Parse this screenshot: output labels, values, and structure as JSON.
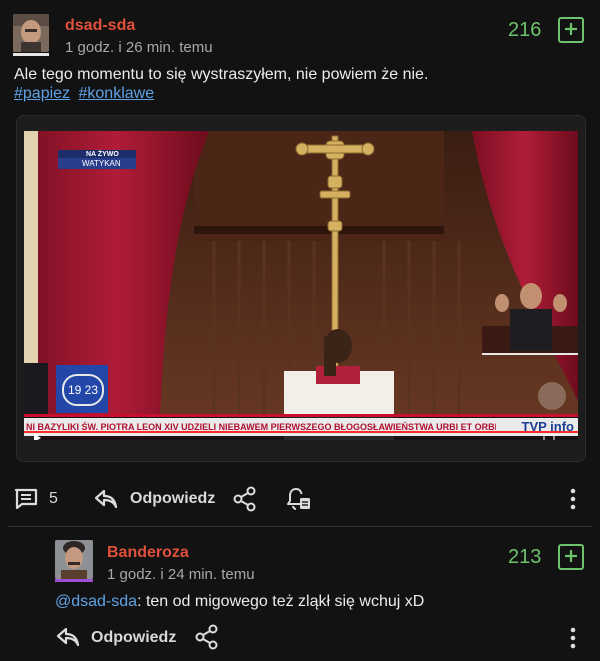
{
  "post": {
    "username": "dsad-sda",
    "time": "1 godz. i 26 min. temu",
    "votes": "216",
    "text": "Ale tego momentu to się wystraszyłem, nie powiem że nie.",
    "tags": [
      "#papiez",
      "#konklawe"
    ],
    "video": {
      "live_line1": "NA ŻYWO",
      "live_line2": "WATYKAN",
      "clock": "19 23",
      "ticker": "NI BAZYLIKI ŚW. PIOTRA LEON XIV UDZIELI NIEBAWEM PIERWSZEGO BŁOGOSŁAWIEŃSTWA URBI ET ORBI",
      "logo": "TVP info"
    },
    "comment_count": "5",
    "reply_label": "Odpowiedz"
  },
  "comment": {
    "username": "Banderoza",
    "time": "1 godz. i 24 min. temu",
    "votes": "213",
    "mention": "@dsad-sda",
    "text": ": ten od migowego też zląkł się wchuj xD",
    "reply_label": "Odpowiedz"
  },
  "icons": {
    "comments": "comments-icon",
    "reply": "reply-arrow-icon",
    "share": "share-icon",
    "notify": "bell-icon",
    "more": "more-vertical-icon",
    "vote": "plus-square-icon"
  },
  "colors": {
    "background": "#121212",
    "username": "#e0503a",
    "votes": "#6cc36c",
    "link": "#5fa3e6",
    "ticker": "#c8102e"
  }
}
